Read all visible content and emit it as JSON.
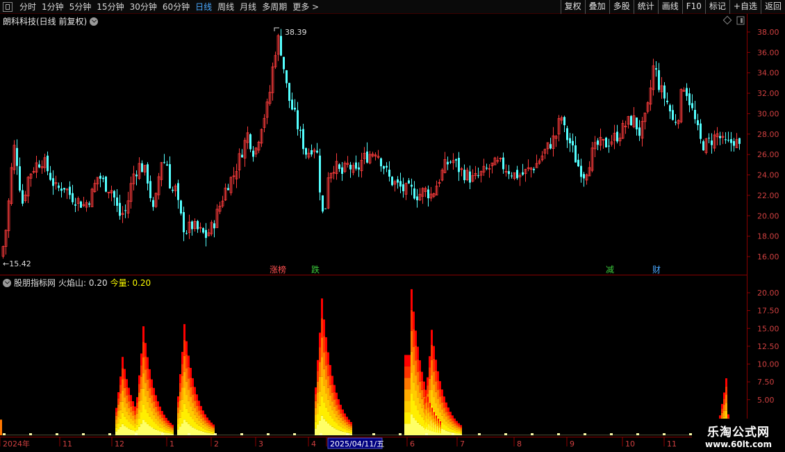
{
  "toolbar": {
    "periods": [
      "分时",
      "1分钟",
      "5分钟",
      "15分钟",
      "30分钟",
      "60分钟",
      "日线",
      "周线",
      "月线",
      "多周期",
      "更多 >"
    ],
    "active_period": "日线",
    "right_buttons": [
      "复权",
      "叠加",
      "多股",
      "统计",
      "画线",
      "F10",
      "标记",
      "+自选",
      "返回"
    ]
  },
  "upper_panel": {
    "title": "朗科科技(日线 前复权)",
    "high_label": "38.39",
    "low_label": "←15.42",
    "y_ticks": [
      "38.00",
      "36.00",
      "34.00",
      "32.00",
      "30.00",
      "28.00",
      "26.00",
      "24.00",
      "22.00",
      "20.00",
      "18.00",
      "16.00"
    ],
    "markers": [
      {
        "text": "涨榜",
        "color": "#ff5050"
      },
      {
        "text": "跌",
        "color": "#3ccc3c"
      },
      {
        "text": "减",
        "color": "#3ccc3c"
      },
      {
        "text": "财",
        "color": "#4aa8ff"
      }
    ]
  },
  "lower_panel": {
    "indicator_name": "股朋指标网",
    "series1_label": "火焰山: 0.20",
    "series2_label": "今量: 0.20",
    "y_ticks": [
      "20.00",
      "17.50",
      "15.00",
      "12.50",
      "10.00",
      "7.50",
      "5.00"
    ]
  },
  "x_axis": {
    "labels": [
      "2024年",
      "11",
      "12",
      "1",
      "2",
      "3",
      "4",
      "2025/04/11/五",
      "6",
      "7",
      "8",
      "9",
      "10",
      "11"
    ]
  },
  "watermark": {
    "line1": "乐淘公式网",
    "line2": "www.60lt.com"
  },
  "colors": {
    "up": "#ff3c3c",
    "down": "#54ffff",
    "axis": "#8b0000",
    "flame_base": "#ffff00",
    "flame_top": "#ff0000"
  },
  "chart_data": {
    "type": "candlestick",
    "title": "朗科科技(日线 前复权)",
    "price_range": [
      15.0,
      39.0
    ],
    "high": 38.39,
    "low": 15.42,
    "approx_closes_by_month": [
      {
        "month": "2024-10",
        "close": 21.0
      },
      {
        "month": "2024-11",
        "close": 23.5
      },
      {
        "month": "2024-12",
        "close": 21.5
      },
      {
        "month": "2025-01",
        "close": 19.0
      },
      {
        "month": "2025-02",
        "close": 26.0
      },
      {
        "month": "2025-03",
        "close": 30.0
      },
      {
        "month": "2025-04",
        "close": 24.5
      },
      {
        "month": "2025-05",
        "close": 22.5
      },
      {
        "month": "2025-06",
        "close": 24.0
      },
      {
        "month": "2025-07",
        "close": 23.8
      },
      {
        "month": "2025-08",
        "close": 25.0
      },
      {
        "month": "2025-09",
        "close": 24.5
      },
      {
        "month": "2025-10",
        "close": 29.0
      },
      {
        "month": "2025-11",
        "close": 27.0
      }
    ],
    "indicator": {
      "name": "火焰山",
      "range": [
        0,
        21
      ],
      "peaks": [
        11.0,
        15.3,
        15.6,
        19.2,
        20.5,
        14.8,
        8.0
      ]
    }
  }
}
